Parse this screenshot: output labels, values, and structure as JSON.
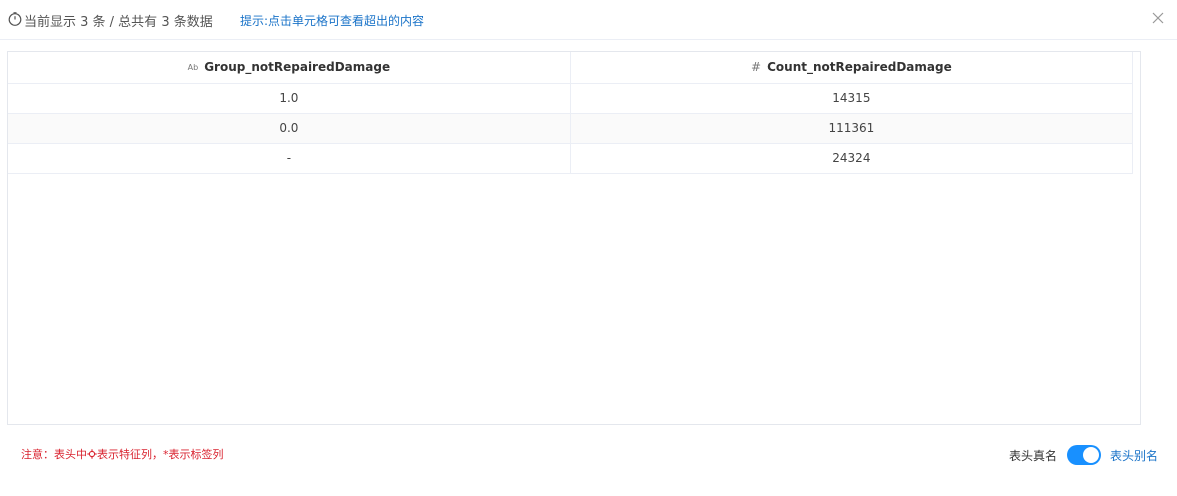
{
  "header": {
    "clock_icon": "clock-icon",
    "summary": "当前显示 3 条 / 总共有 3 条数据",
    "hint": "提示:点击单元格可查看超出的内容",
    "close_icon": "close-icon"
  },
  "table": {
    "columns": [
      {
        "icon": "Ab",
        "icon_name": "text-type-icon",
        "label": "Group_notRepairedDamage"
      },
      {
        "icon": "#",
        "icon_name": "number-type-icon",
        "label": "Count_notRepairedDamage"
      }
    ],
    "rows": [
      [
        "1.0",
        "14315"
      ],
      [
        "0.0",
        "111361"
      ],
      [
        "-",
        "24324"
      ]
    ]
  },
  "footer": {
    "note_prefix": "注意：表头中",
    "note_icon": "gear-icon",
    "note_suffix": "表示特征列，*表示标签列",
    "real_label": "表头真名",
    "alias_label": "表头别名",
    "toggle_on": true
  },
  "colors": {
    "accent": "#1890ff",
    "link": "#1a73c8",
    "warning": "#d9232f"
  }
}
